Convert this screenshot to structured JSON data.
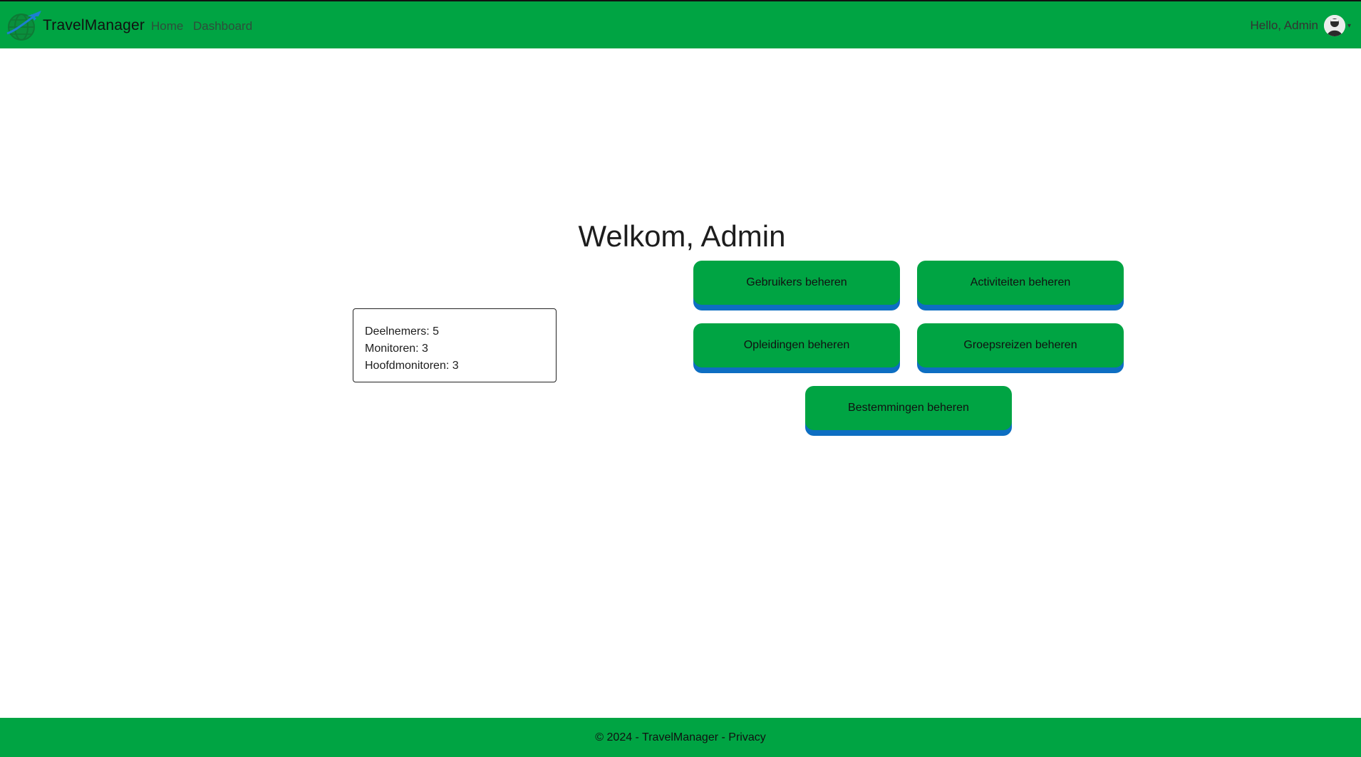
{
  "app": {
    "brand_name": "TravelManager",
    "brand_logo_icon": "globe-plane-icon"
  },
  "nav": {
    "home": "Home",
    "dashboard": "Dashboard"
  },
  "user": {
    "greeting": "Hello, Admin",
    "avatar_icon": "user-avatar-icon",
    "caret": "▾"
  },
  "main": {
    "welcome": "Welkom, Admin"
  },
  "stats": {
    "deelnemers": "Deelnemers: 5",
    "monitoren": "Monitoren: 3",
    "hoofdmonitoren": "Hoofdmonitoren: 3"
  },
  "actions": {
    "users": "Gebruikers beheren",
    "activities": "Activiteiten beheren",
    "trainings": "Opleidingen beheren",
    "trips": "Groepsreizen beheren",
    "destinations": "Bestemmingen beheren"
  },
  "footer": {
    "copyright": "© 2024 - TravelManager - ",
    "privacy": "Privacy"
  },
  "colors": {
    "primary_green": "#00a443",
    "button_shadow_blue": "#0d6ec2"
  }
}
